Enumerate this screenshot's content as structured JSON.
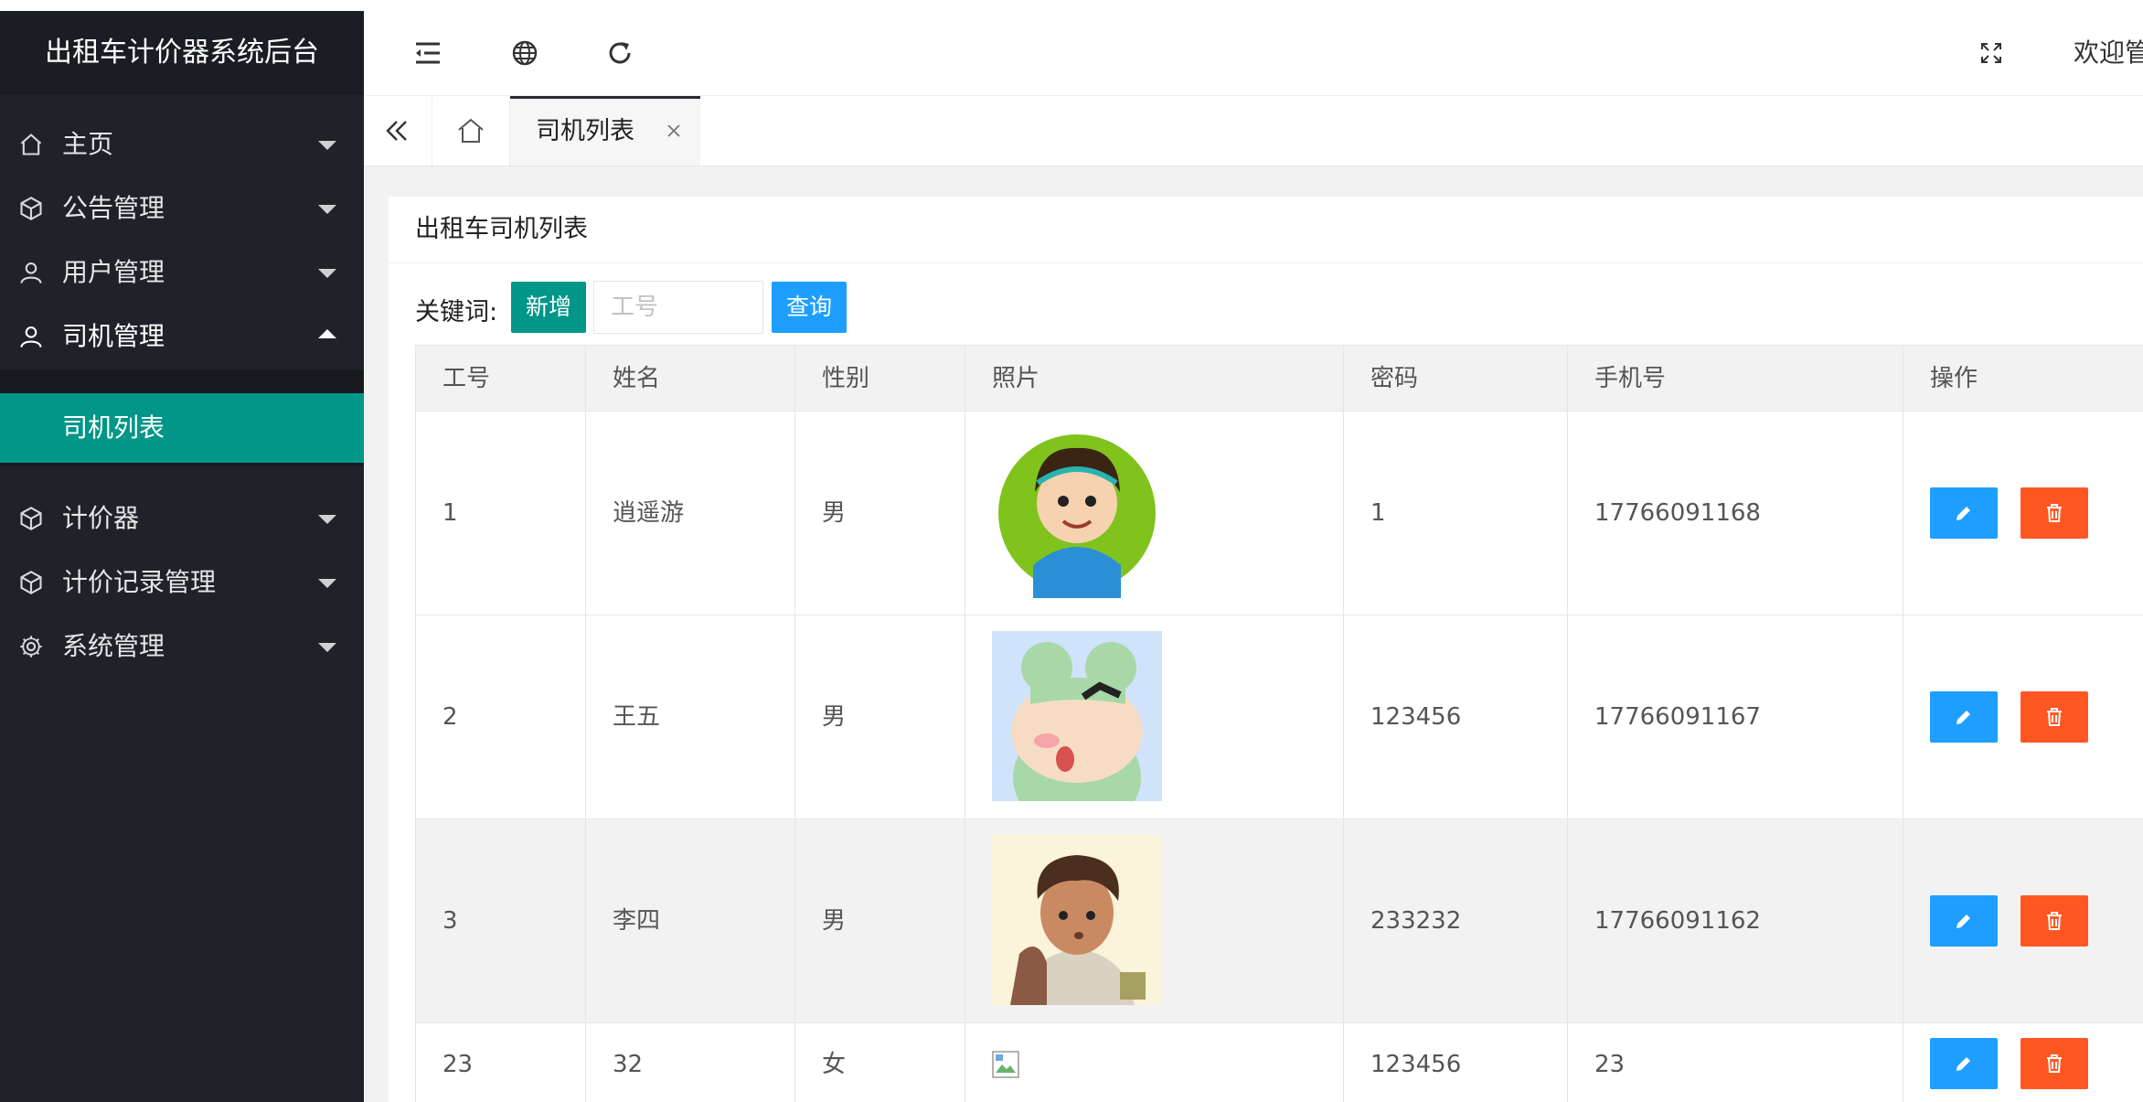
{
  "app": {
    "title": "出租车计价器系统后台",
    "welcome": "欢迎管"
  },
  "sidebar": {
    "items": [
      {
        "label": "主页",
        "icon": "home-icon"
      },
      {
        "label": "公告管理",
        "icon": "cube-icon"
      },
      {
        "label": "用户管理",
        "icon": "user-icon"
      },
      {
        "label": "司机管理",
        "icon": "user-icon",
        "expanded": true
      },
      {
        "label": "计价器",
        "icon": "cube-icon"
      },
      {
        "label": "计价记录管理",
        "icon": "cube-icon"
      },
      {
        "label": "系统管理",
        "icon": "gear-icon"
      }
    ],
    "sub_item": {
      "label": "司机列表"
    }
  },
  "header": {
    "icons": [
      "menu-fold-icon",
      "globe-icon",
      "refresh-icon",
      "fullscreen-icon"
    ]
  },
  "tabs": {
    "active_label": "司机列表"
  },
  "page": {
    "card_title": "出租车司机列表",
    "keyword_label": "关键词:",
    "add_label": "新增",
    "search_placeholder": "工号",
    "query_label": "查询"
  },
  "table": {
    "columns": [
      "工号",
      "姓名",
      "性别",
      "照片",
      "密码",
      "手机号",
      "操作"
    ],
    "rows": [
      {
        "id": "1",
        "name": "逍遥游",
        "gender": "男",
        "photo": "avatar-boy-headphones",
        "password": "1",
        "phone": "17766091168"
      },
      {
        "id": "2",
        "name": "王五",
        "gender": "男",
        "photo": "avatar-frog-hat",
        "password": "123456",
        "phone": "17766091167"
      },
      {
        "id": "3",
        "name": "李四",
        "gender": "男",
        "photo": "avatar-boy-backpack",
        "password": "233232",
        "phone": "17766091162"
      },
      {
        "id": "23",
        "name": "32",
        "gender": "女",
        "photo": "broken-image",
        "password": "123456",
        "phone": "23"
      }
    ]
  },
  "colors": {
    "sidebar": "#20222a",
    "accent": "#009688",
    "primary": "#1e9fff",
    "danger": "#ff5722"
  }
}
